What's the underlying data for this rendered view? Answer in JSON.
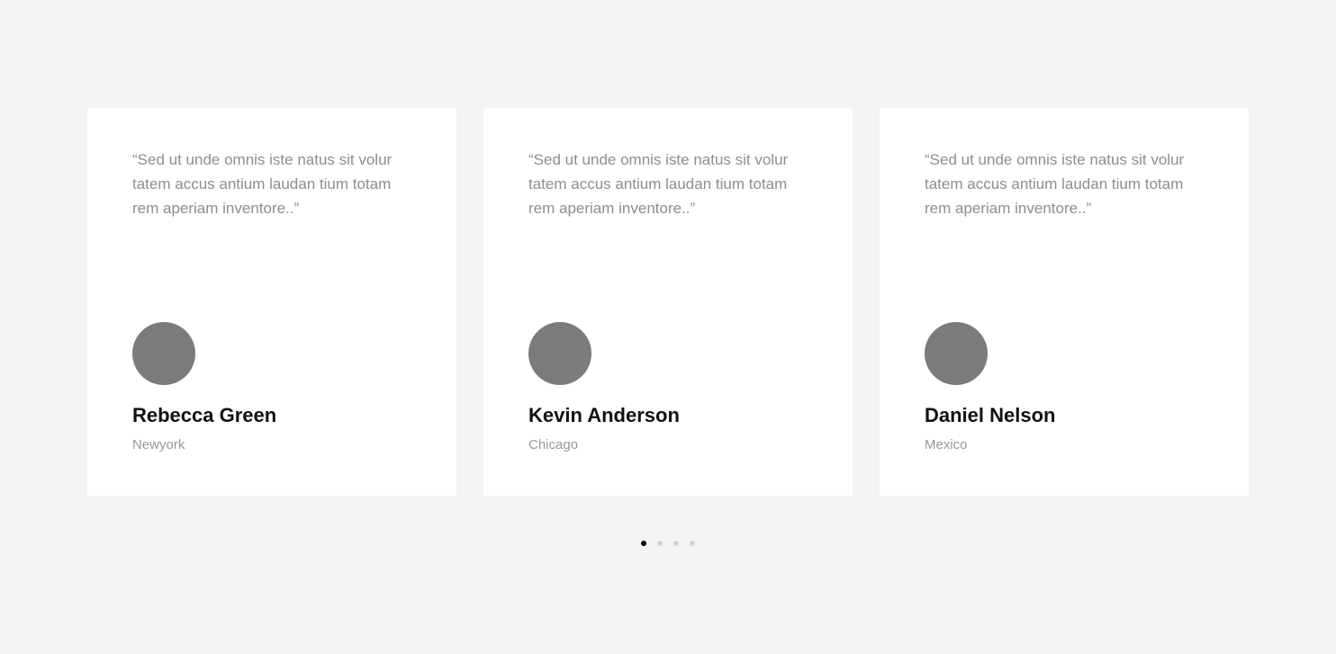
{
  "testimonials": [
    {
      "quote": "“Sed ut unde omnis iste natus sit volur tatem accus antium laudan tium totam rem aperiam inventore..”",
      "name": "Rebecca Green",
      "location": "Newyork"
    },
    {
      "quote": "“Sed ut unde omnis iste natus sit volur tatem accus antium laudan tium totam rem aperiam inventore..”",
      "name": "Kevin Anderson",
      "location": "Chicago"
    },
    {
      "quote": "“Sed ut unde omnis iste natus sit volur tatem accus antium laudan tium totam rem aperiam inventore..”",
      "name": "Daniel Nelson",
      "location": "Mexico"
    }
  ],
  "pagination": {
    "total": 4,
    "active_index": 0
  },
  "colors": {
    "page_background": "#f4f4f4",
    "card_background": "#ffffff",
    "quote_text": "#8e8e8e",
    "avatar_placeholder": "#7a7b7c",
    "name_text": "#111111",
    "location_text": "#999999",
    "dot_active": "#000000",
    "dot_inactive": "#d2d2d2"
  }
}
